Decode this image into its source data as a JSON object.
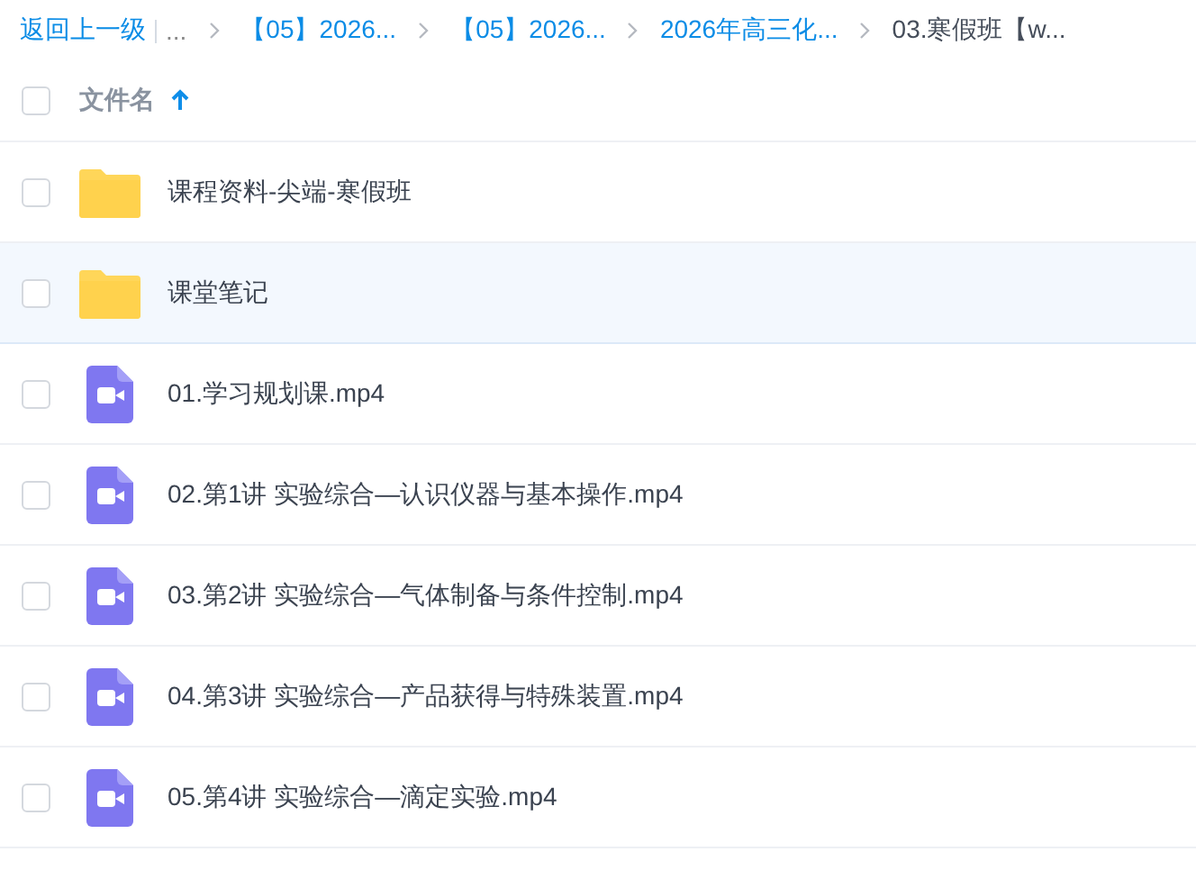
{
  "breadcrumb": {
    "back": "返回上一级",
    "ellipsis": "...",
    "items": [
      {
        "label": "【05】2026...",
        "current": false
      },
      {
        "label": "【05】2026...",
        "current": false
      },
      {
        "label": "2026年高三化...",
        "current": false
      },
      {
        "label": "03.寒假班【w...",
        "current": true
      }
    ]
  },
  "header": {
    "checked": false,
    "column": "文件名",
    "ascending": true
  },
  "files": [
    {
      "kind": "folder",
      "name": "课程资料-尖端-寒假班",
      "checked": false,
      "highlighted": false
    },
    {
      "kind": "folder",
      "name": "课堂笔记",
      "checked": false,
      "highlighted": true
    },
    {
      "kind": "video",
      "name": "01.学习规划课.mp4",
      "checked": false,
      "highlighted": false
    },
    {
      "kind": "video",
      "name": "02.第1讲 实验综合—认识仪器与基本操作.mp4",
      "checked": false,
      "highlighted": false
    },
    {
      "kind": "video",
      "name": "03.第2讲 实验综合—气体制备与条件控制.mp4",
      "checked": false,
      "highlighted": false
    },
    {
      "kind": "video",
      "name": "04.第3讲 实验综合—产品获得与特殊装置.mp4",
      "checked": false,
      "highlighted": false
    },
    {
      "kind": "video",
      "name": "05.第4讲 实验综合—滴定实验.mp4",
      "checked": false,
      "highlighted": false
    }
  ]
}
